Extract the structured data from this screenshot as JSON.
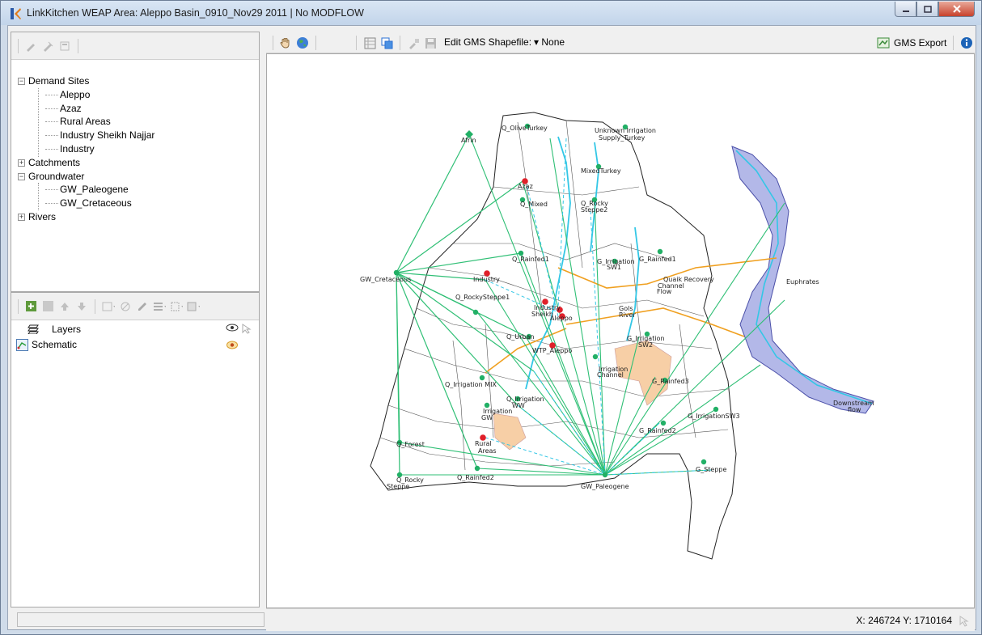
{
  "window": {
    "title": "LinkKitchen   WEAP Area: Aleppo Basin_0910_Nov29 2011 | No MODFLOW"
  },
  "tree": {
    "nodes": [
      {
        "label": "Demand Sites",
        "expander": "−"
      },
      {
        "label": "Aleppo"
      },
      {
        "label": "Azaz"
      },
      {
        "label": "Rural Areas"
      },
      {
        "label": "Industry Sheikh Najjar"
      },
      {
        "label": "Industry"
      },
      {
        "label": "Catchments",
        "expander": "+"
      },
      {
        "label": "Groundwater",
        "expander": "−"
      },
      {
        "label": "GW_Paleogene"
      },
      {
        "label": "GW_Cretaceous"
      },
      {
        "label": "Rivers",
        "expander": "+"
      }
    ]
  },
  "layers": {
    "header": "Layers",
    "items": [
      {
        "label": "Schematic"
      }
    ]
  },
  "map_toolbar": {
    "shapefile_label": "Edit GMS Shapefile:",
    "shapefile_value": "None",
    "export_label": "GMS Export"
  },
  "status": {
    "x": "X: 246724",
    "y": "Y: 1710164"
  },
  "map": {
    "labels": [
      "Q_OliveTurkey",
      "Unknown Irrigation",
      "Supply_Turkey",
      "Afrin",
      "MixedTurkey",
      "Q_Mixed",
      "Q_Rocky",
      "Steppe2",
      "Azaz",
      "Q_Rainfed1",
      "G_Irrigation",
      "SW1",
      "G_Rainfed1",
      "GW_Cretaceous",
      "Industry",
      "Quaik Recovery",
      "Channel",
      "Flow",
      "Euphrates",
      "Q_RockySteppe1",
      "Industry",
      "Sheikh",
      "Aleppo",
      "Gols",
      "River",
      "G_Irrigation",
      "SW2",
      "Q_Urban",
      "WTP_Aleppo",
      "Irrigation",
      "Channel",
      "G_Rainfed3",
      "Q_Irrigation MIX",
      "Q_Irrigation",
      "WW",
      "Irrigation",
      "GW",
      "G_IrrigationSW3",
      "Downstream",
      "flow",
      "G_Rainfed2",
      "Q_Forest",
      "Rural",
      "Areas",
      "Q_Rocky",
      "Steppe",
      "Q_Rainfed2",
      "G_Steppe",
      "GW_Paleogene"
    ],
    "colors": {
      "gw_link": "#2fbf75",
      "river": "#33c7e6",
      "canal": "#f0a020",
      "demand": "#e0202a",
      "catch": "#22b066",
      "lake": "#9aa0e0",
      "irrigated_area": "#f7cfa6"
    }
  }
}
